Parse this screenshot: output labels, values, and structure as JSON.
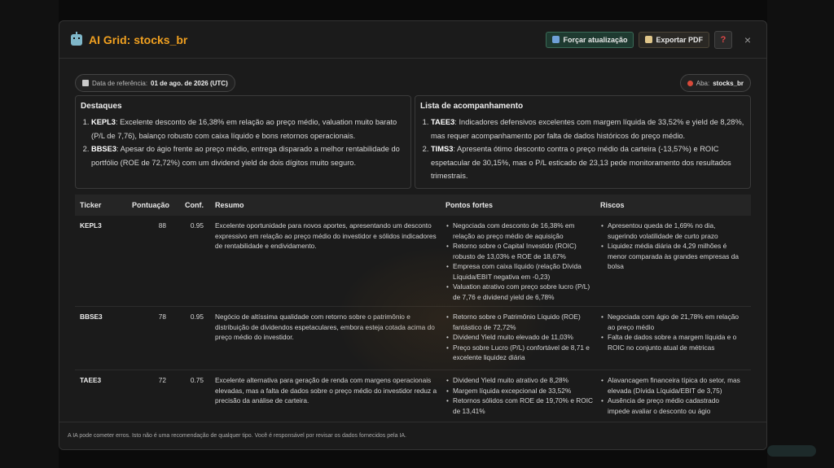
{
  "modal": {
    "title": "AI Grid: stocks_br",
    "refresh_label": "Forçar atualização",
    "export_label": "Exportar PDF",
    "help_label": "?",
    "close_label": "×"
  },
  "meta": {
    "ref_label": "Data de referência:",
    "ref_value": "01 de ago. de 2026 (UTC)",
    "tab_label": "Aba:",
    "tab_value": "stocks_br"
  },
  "highlights": {
    "title": "Destaques",
    "items": [
      {
        "ticker": "KEPL3",
        "text": ": Excelente desconto de 16,38% em relação ao preço médio, valuation muito barato (P/L de 7,76), balanço robusto com caixa líquido e bons retornos operacionais."
      },
      {
        "ticker": "BBSE3",
        "text": ": Apesar do ágio frente ao preço médio, entrega disparado a melhor rentabilidade do portfólio (ROE de 72,72%) com um dividend yield de dois dígitos muito seguro."
      }
    ]
  },
  "watchlist": {
    "title": "Lista de acompanhamento",
    "items": [
      {
        "ticker": "TAEE3",
        "text": ": Indicadores defensivos excelentes com margem líquida de 33,52% e yield de 8,28%, mas requer acompanhamento por falta de dados históricos do preço médio."
      },
      {
        "ticker": "TIMS3",
        "text": ": Apresenta ótimo desconto contra o preço médio da carteira (-13,57%) e ROIC espetacular de 30,15%, mas o P/L esticado de 23,13 pede monitoramento dos resultados trimestrais."
      }
    ]
  },
  "table": {
    "headers": {
      "ticker": "Ticker",
      "score": "Pontuação",
      "conf": "Conf.",
      "summary": "Resumo",
      "strengths": "Pontos fortes",
      "risks": "Riscos"
    },
    "rows": [
      {
        "ticker": "KEPL3",
        "score": "88",
        "conf": "0.95",
        "summary": "Excelente oportunidade para novos aportes, apresentando um desconto expressivo em relação ao preço médio do investidor e sólidos indicadores de rentabilidade e endividamento.",
        "strengths": [
          "Negociada com desconto de 16,38% em relação ao preço médio de aquisição",
          "Retorno sobre o Capital Investido (ROIC) robusto de 13,03% e ROE de 18,67%",
          "Empresa com caixa líquido (relação Dívida Líquida/EBIT negativa em -0,23)",
          "Valuation atrativo com preço sobre lucro (P/L) de 7,76 e dividend yield de 6,78%"
        ],
        "risks": [
          "Apresentou queda de 1,69% no dia, sugerindo volatilidade de curto prazo",
          "Liquidez média diária de 4,29 milhões é menor comparada às grandes empresas da bolsa"
        ]
      },
      {
        "ticker": "BBSE3",
        "score": "78",
        "conf": "0.95",
        "summary": "Negócio de altíssima qualidade com retorno sobre o patrimônio e distribuição de dividendos espetaculares, embora esteja cotada acima do preço médio do investidor.",
        "strengths": [
          "Retorno sobre o Patrimônio Líquido (ROE) fantástico de 72,72%",
          "Dividend Yield muito elevado de 11,03%",
          "Preço sobre Lucro (P/L) confortável de 8,71 e excelente liquidez diária"
        ],
        "risks": [
          "Negociada com ágio de 21,78% em relação ao preço médio",
          "Falta de dados sobre a margem líquida e o ROIC no conjunto atual de métricas"
        ]
      },
      {
        "ticker": "TAEE3",
        "score": "72",
        "conf": "0.75",
        "summary": "Excelente alternativa para geração de renda com margens operacionais elevadas, mas a falta de dados sobre o preço médio do investidor reduz a precisão da análise de carteira.",
        "strengths": [
          "Dividend Yield muito atrativo de 8,28%",
          "Margem líquida excepcional de 33,52%",
          "Retornos sólidos com ROE de 19,70% e ROIC de 13,41%"
        ],
        "risks": [
          "Alavancagem financeira típica do setor, mas elevada (Dívida Líquida/EBIT de 3,75)",
          "Ausência de preço médio cadastrado impede avaliar o desconto ou ágio"
        ]
      }
    ]
  },
  "footer": "A IA pode cometer erros. Isto não é uma recomendação de qualquer tipo. Você é responsável por revisar os dados fornecidos pela IA."
}
